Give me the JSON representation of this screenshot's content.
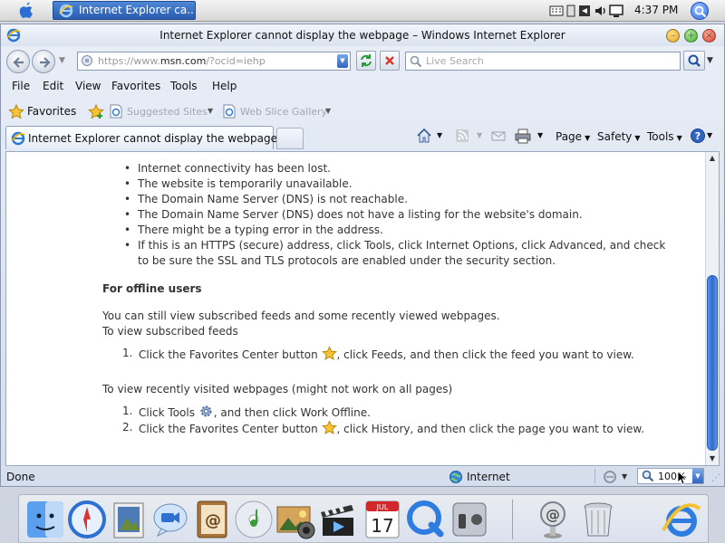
{
  "mac_menubar": {
    "task_button_label": "Internet Explorer ca...",
    "clock": "4:37 PM"
  },
  "window": {
    "title": "Internet Explorer cannot display the webpage – Windows Internet Explorer"
  },
  "address_bar": {
    "url_prefix": "https://www.",
    "url_domain": "msn.com",
    "url_suffix": "/?ocid=iehp",
    "search_placeholder": "Live Search"
  },
  "menu": {
    "items": [
      "File",
      "Edit",
      "View",
      "Favorites",
      "Tools",
      "Help"
    ]
  },
  "favorites_bar": {
    "favorites_label": "Favorites",
    "suggested_sites": "Suggested Sites",
    "web_slice_gallery": "Web Slice Gallery"
  },
  "tab": {
    "label": "Internet Explorer cannot display the webpage"
  },
  "command_bar": {
    "page": "Page",
    "safety": "Safety",
    "tools": "Tools"
  },
  "content": {
    "causes": [
      "Internet connectivity has been lost.",
      "The website is temporarily unavailable.",
      "The Domain Name Server (DNS) is not reachable.",
      "The Domain Name Server (DNS) does not have a listing for the website's domain.",
      "There might be a typing error in the address.",
      "If this is an HTTPS (secure) address, click Tools, click Internet Options, click Advanced, and check to be sure the SSL and TLS protocols are enabled under the security section."
    ],
    "offline_heading": "For offline users",
    "offline_para": "You can still view subscribed feeds and some recently viewed webpages.",
    "feeds_intro": "To view subscribed feeds",
    "feeds_steps": [
      {
        "num": "1.",
        "before": "Click the Favorites Center button",
        "after": ", click Feeds, and then click the feed you want to view."
      }
    ],
    "recent_intro": "To view recently visited webpages (might not work on all pages)",
    "recent_steps": [
      {
        "num": "1.",
        "before": "Click Tools",
        "after": ", and then click Work Offline."
      },
      {
        "num": "2.",
        "before": "Click the Favorites Center button",
        "after": ", click History, and then click the page you want to view."
      }
    ]
  },
  "status_bar": {
    "status": "Done",
    "zone": "Internet",
    "zoom": "100%"
  },
  "dock": {
    "items": [
      "finder-icon",
      "safari-icon",
      "preview-icon",
      "ichat-icon",
      "address-book-icon",
      "itunes-icon",
      "iphoto-icon",
      "imovie-icon",
      "ical-icon",
      "quicktime-icon",
      "system-preferences-icon",
      "mail-icon",
      "trash-icon",
      "internet-explorer-icon"
    ],
    "ical_day": "17",
    "ical_month": "JUL"
  }
}
